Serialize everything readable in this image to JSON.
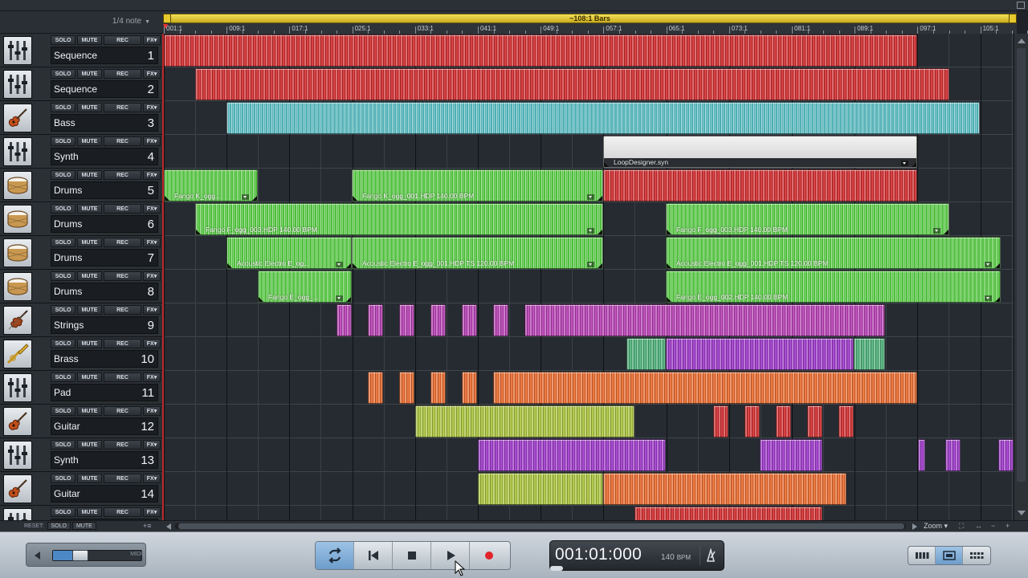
{
  "header": {
    "quantize": "1/4 note",
    "loop_range": "~108:1 Bars"
  },
  "ruler": {
    "labels": [
      "001:1",
      "009:1",
      "017:1",
      "025:1",
      "033:1",
      "041:1",
      "049:1",
      "057:1",
      "065:1",
      "073:1",
      "081:1",
      "089:1",
      "097:1",
      "105:1"
    ]
  },
  "track_buttons": {
    "solo": "SOLO",
    "mute": "MUTE",
    "rec": "REC",
    "fx": "FX"
  },
  "tracks": [
    {
      "name": "Sequence",
      "number": "1",
      "icon": "mixer-icon"
    },
    {
      "name": "Sequence",
      "number": "2",
      "icon": "mixer-icon"
    },
    {
      "name": "Bass",
      "number": "3",
      "icon": "guitar-icon"
    },
    {
      "name": "Synth",
      "number": "4",
      "icon": "mixer-icon"
    },
    {
      "name": "Drums",
      "number": "5",
      "icon": "drum-icon"
    },
    {
      "name": "Drums",
      "number": "6",
      "icon": "drum-icon"
    },
    {
      "name": "Drums",
      "number": "7",
      "icon": "drum-icon"
    },
    {
      "name": "Drums",
      "number": "8",
      "icon": "drum-icon"
    },
    {
      "name": "Strings",
      "number": "9",
      "icon": "violin-icon"
    },
    {
      "name": "Brass",
      "number": "10",
      "icon": "trumpet-icon"
    },
    {
      "name": "Pad",
      "number": "11",
      "icon": "mixer-icon"
    },
    {
      "name": "Guitar",
      "number": "12",
      "icon": "guitar-icon"
    },
    {
      "name": "Synth",
      "number": "13",
      "icon": "mixer-icon"
    },
    {
      "name": "Guitar",
      "number": "14",
      "icon": "guitar-icon"
    },
    {
      "name": "",
      "number": "",
      "icon": "mixer-icon"
    }
  ],
  "clip_labels": {
    "loopdesigner": "LoopDesigner.syn",
    "fango_k_short": "Fango K_ogg...",
    "fango_k": "Fango K_ogg_001.HDP  140.00 BPM",
    "fango_f_short": "Fango F_ogg_003.HDP  140.00 BPM",
    "fango_f": "Fango F_ogg_003.HDP  140.00 BPM",
    "acoustic_short": "Acoustic Electro E_og...",
    "acoustic": "Acoustic Electro E_ogg_001.HDP  TS  120.00 BPM",
    "fango_e_short": "Fango E_ogg_...",
    "fango_e": "Fango E_ogg_002.HDP  140.00 BPM"
  },
  "bottom_bar": {
    "reset": "RESET:",
    "solo": "SOLO",
    "mute": "MUTE",
    "zoom": "Zoom"
  },
  "transport": {
    "midi_label": "MIDI",
    "time": "001:01:000",
    "tempo": "140",
    "tempo_unit": "BPM",
    "volume_level": 0.25
  },
  "colors": {
    "red": "#cf2a2c",
    "teal": "#4fb0b5",
    "green": "#4fbf3c",
    "magenta": "#b53db2",
    "purple": "#9b36c7",
    "sea_green": "#4bae78",
    "orange": "#e8692c",
    "lime": "#a8c23b",
    "light": "#e9e9e9"
  }
}
